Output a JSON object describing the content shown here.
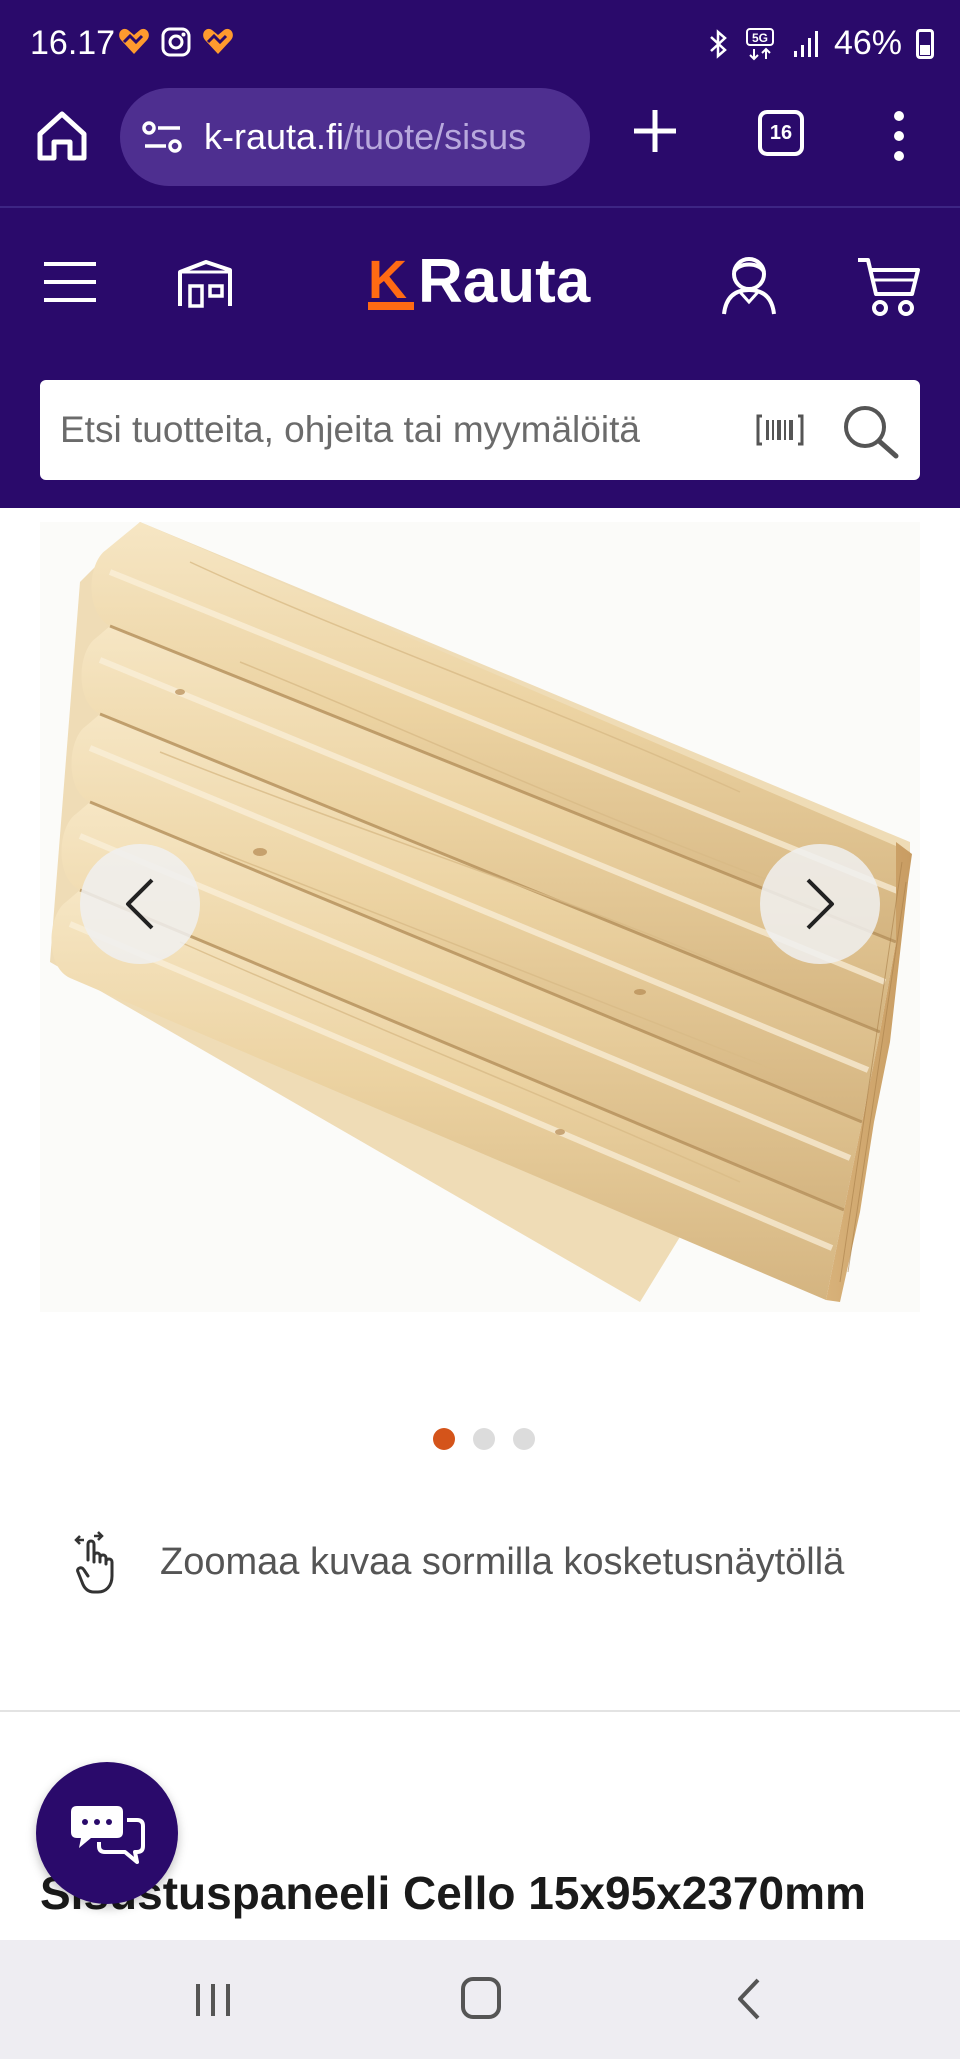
{
  "status_bar": {
    "time": "16.17",
    "battery": "46%",
    "icons": [
      "heart-notification-icon",
      "instagram-icon",
      "heart-notification-icon",
      "bluetooth-icon",
      "5g-icon",
      "signal-icon",
      "battery-icon"
    ]
  },
  "browser": {
    "url_domain": "k-rauta.fi",
    "url_path": "/tuote/sisus",
    "tab_count": "16"
  },
  "header": {
    "logo_k": "K",
    "logo_text": "Rauta",
    "brand_color": "#2a0a6b",
    "accent_color": "#ff6a13"
  },
  "search": {
    "placeholder": "Etsi tuotteita, ohjeita tai myymälöitä"
  },
  "gallery": {
    "image_count": 3,
    "active_index": 0
  },
  "zoom_hint": "Zoomaa kuvaa sormilla kosketusnäytöllä",
  "product": {
    "title": "Sisustuspaneeli Cello 15x95x2370mm"
  }
}
